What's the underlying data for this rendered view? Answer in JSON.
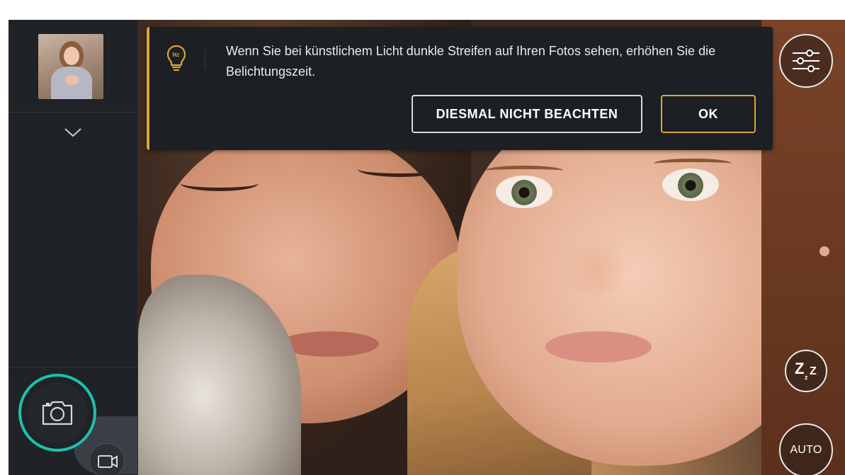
{
  "notification": {
    "message": "Wenn Sie bei künstlichem Licht dunkle Streifen auf Ihren Fotos sehen, erhöhen Sie die Belichtungszeit.",
    "ignore_label": "DIESMAL NICHT BEACHTEN",
    "ok_label": "OK",
    "accent_color": "#d9a53a",
    "icon": "lightbulb-icon"
  },
  "controls": {
    "auto_label": "AUTO",
    "sleep_z_large": "Z",
    "sleep_z_medium": "Z",
    "sleep_z_small": "z",
    "settings_icon": "sliders-icon",
    "sleep_icon": "sleep-icon"
  },
  "sidebar": {
    "expand_icon": "chevron-down-icon",
    "photo_icon": "camera-icon",
    "video_icon": "video-camera-icon",
    "shutter_ring_color": "#1fbfb0"
  }
}
